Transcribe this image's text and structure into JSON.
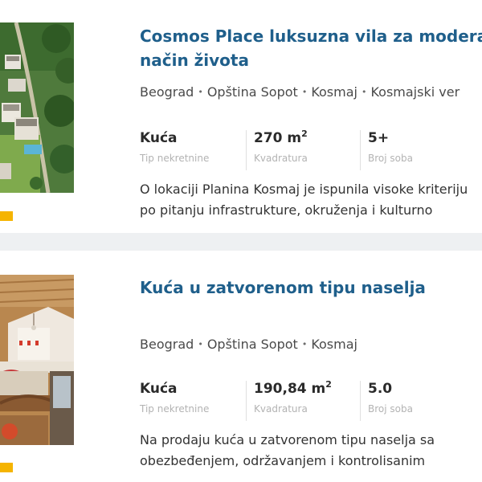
{
  "listings": [
    {
      "title_lines": [
        "Cosmos Place luksuzna vila za modera",
        "način života"
      ],
      "location": [
        "Beograd",
        "Opština Sopot",
        "Kosmaj",
        "Kosmajski ver"
      ],
      "type_value": "Kuća",
      "type_label": "Tip nekretnine",
      "area_value": "270 m",
      "area_sup": "2",
      "area_label": "Kvadratura",
      "rooms_value": "5+",
      "rooms_label": "Broj soba",
      "description_lines": [
        "O lokaciji Planina Kosmaj je ispunila visoke kriteriju",
        "po pitanju infrastrukture, okruženja i kulturno"
      ]
    },
    {
      "title_lines": [
        "Kuća u zatvorenom tipu naselja"
      ],
      "location": [
        "Beograd",
        "Opština Sopot",
        "Kosmaj"
      ],
      "type_value": "Kuća",
      "type_label": "Tip nekretnine",
      "area_value": "190,84 m",
      "area_sup": "2",
      "area_label": "Kvadratura",
      "rooms_value": "5.0",
      "rooms_label": "Broj soba",
      "description_lines": [
        "Na prodaju kuća u zatvorenom tipu naselja sa",
        "obezbeđenjem, održavanjem i kontrolisanim"
      ]
    }
  ],
  "location_separator": "•",
  "colors": {
    "title": "#1f5f8b",
    "tag": "#f5b400",
    "separator_band": "#eef0f2"
  },
  "icons": {
    "photo_1": "aerial-villa-photo",
    "photo_2": "interior-living-room-photo"
  }
}
